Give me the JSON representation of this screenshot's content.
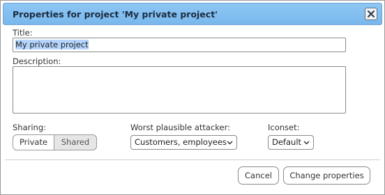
{
  "dialog": {
    "title": "Properties for project 'My private project'",
    "close_icon": "close-icon"
  },
  "form": {
    "title_label": "Title:",
    "title_value": "My private project",
    "description_label": "Description:",
    "description_value": "",
    "sharing_label": "Sharing:",
    "sharing_options": [
      "Private",
      "Shared"
    ],
    "sharing_selected": "Private",
    "attacker_label": "Worst plausible attacker:",
    "attacker_value": "Customers, employees",
    "iconset_label": "Iconset:",
    "iconset_value": "Default"
  },
  "actions": {
    "cancel_label": "Cancel",
    "submit_label": "Change properties"
  },
  "colors": {
    "titlebar": "#79b7ec",
    "selection": "#b5d5ff"
  }
}
